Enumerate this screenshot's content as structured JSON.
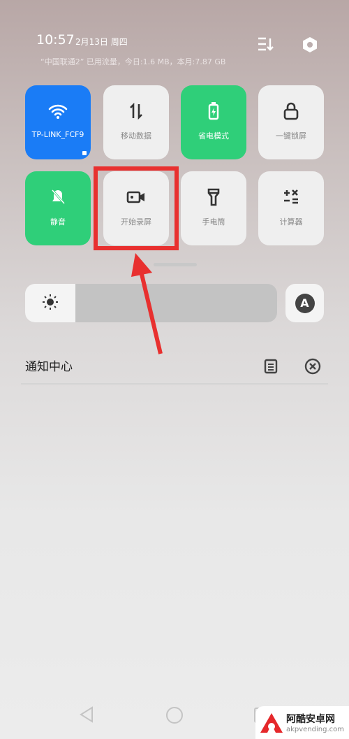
{
  "status": {
    "time": "10:57",
    "date": "2月13日 周四",
    "usage": "“中国联通2” 已用流量，今日:1.6 MB，本月:7.87 GB"
  },
  "tiles": [
    {
      "label": "TP-LINK_FCF9",
      "icon": "wifi-icon",
      "state": "on",
      "color": "#1a7cf6"
    },
    {
      "label": "移动数据",
      "icon": "mobile-data-icon",
      "state": "off"
    },
    {
      "label": "省电模式",
      "icon": "battery-saver-icon",
      "state": "on",
      "color": "#2fcf79"
    },
    {
      "label": "一键锁屏",
      "icon": "lock-icon",
      "state": "off"
    },
    {
      "label": "静音",
      "icon": "bell-off-icon",
      "state": "on",
      "color": "#2fcf79"
    },
    {
      "label": "开始录屏",
      "icon": "screen-record-icon",
      "state": "off",
      "highlighted": true
    },
    {
      "label": "手电筒",
      "icon": "flashlight-icon",
      "state": "off"
    },
    {
      "label": "计算器",
      "icon": "calculator-icon",
      "state": "off"
    }
  ],
  "brightness": {
    "level": 0.2,
    "auto_label": "A"
  },
  "notifications": {
    "title": "通知中心"
  },
  "annotation_color": "#e8302f",
  "watermark": {
    "name": "阿酷安卓网",
    "url": "akpvending.com"
  }
}
